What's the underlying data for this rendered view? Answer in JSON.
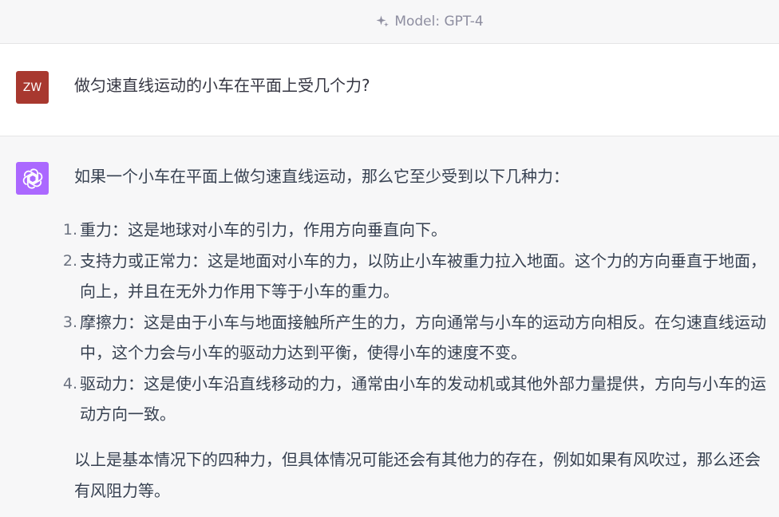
{
  "header": {
    "model_label": "Model: GPT-4",
    "icon": "sparkle-icon"
  },
  "user_message": {
    "avatar_initials": "ZW",
    "avatar_color": "#a8382f",
    "text": "做匀速直线运动的小车在平面上受几个力?"
  },
  "assistant_message": {
    "avatar_icon": "openai-logo-icon",
    "avatar_color": "#ab68ff",
    "intro": "如果一个小车在平面上做匀速直线运动，那么它至少受到以下几种力：",
    "items": [
      {
        "num": "1.",
        "text": "重力：这是地球对小车的引力，作用方向垂直向下。"
      },
      {
        "num": "2.",
        "text": "支持力或正常力：这是地面对小车的力，以防止小车被重力拉入地面。这个力的方向垂直于地面，向上，并且在无外力作用下等于小车的重力。"
      },
      {
        "num": "3.",
        "text": "摩擦力：这是由于小车与地面接触所产生的力，方向通常与小车的运动方向相反。在匀速直线运动中，这个力会与小车的驱动力达到平衡，使得小车的速度不变。"
      },
      {
        "num": "4.",
        "text": "驱动力：这是使小车沿直线移动的力，通常由小车的发动机或其他外部力量提供，方向与小车的运动方向一致。"
      }
    ],
    "outro": "以上是基本情况下的四种力，但具体情况可能还会有其他力的存在，例如如果有风吹过，那么还会有风阻力等。"
  }
}
